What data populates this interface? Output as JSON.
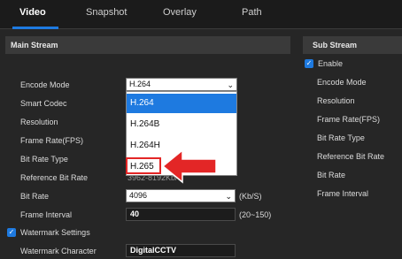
{
  "tabs": [
    {
      "label": "Video"
    },
    {
      "label": "Snapshot"
    },
    {
      "label": "Overlay"
    },
    {
      "label": "Path"
    }
  ],
  "main_stream": {
    "title": "Main Stream",
    "encode_mode": {
      "label": "Encode Mode",
      "value": "H.264"
    },
    "smart_codec": {
      "label": "Smart Codec"
    },
    "resolution": {
      "label": "Resolution"
    },
    "frame_rate": {
      "label": "Frame Rate(FPS)"
    },
    "bit_rate_type": {
      "label": "Bit Rate Type"
    },
    "reference_bit_rate": {
      "label": "Reference Bit Rate",
      "value": "3962-8192Kb/S"
    },
    "bit_rate": {
      "label": "Bit Rate",
      "value": "4096",
      "unit": "(Kb/S)"
    },
    "frame_interval": {
      "label": "Frame Interval",
      "value": "40",
      "range": "(20~150)"
    },
    "watermark_settings": {
      "label": "Watermark Settings",
      "checked": true
    },
    "watermark_character": {
      "label": "Watermark Character",
      "value": "DigitalCCTV"
    }
  },
  "encode_dropdown": {
    "options": [
      "H.264",
      "H.264B",
      "H.264H",
      "H.265"
    ],
    "highlighted": "H.264",
    "marked": "H.265"
  },
  "sub_stream": {
    "title": "Sub Stream",
    "enable": {
      "label": "Enable",
      "checked": true
    },
    "labels": [
      "Encode Mode",
      "Resolution",
      "Frame Rate(FPS)",
      "Bit Rate Type",
      "Reference Bit Rate",
      "Bit Rate",
      "Frame Interval"
    ]
  },
  "colors": {
    "accent": "#1e7ae0",
    "annotation_red": "#e32626",
    "background": "#262626"
  },
  "icons": {
    "checkbox": "check-icon",
    "select": "chevron-down-icon",
    "annotation": "red-arrow-icon"
  }
}
